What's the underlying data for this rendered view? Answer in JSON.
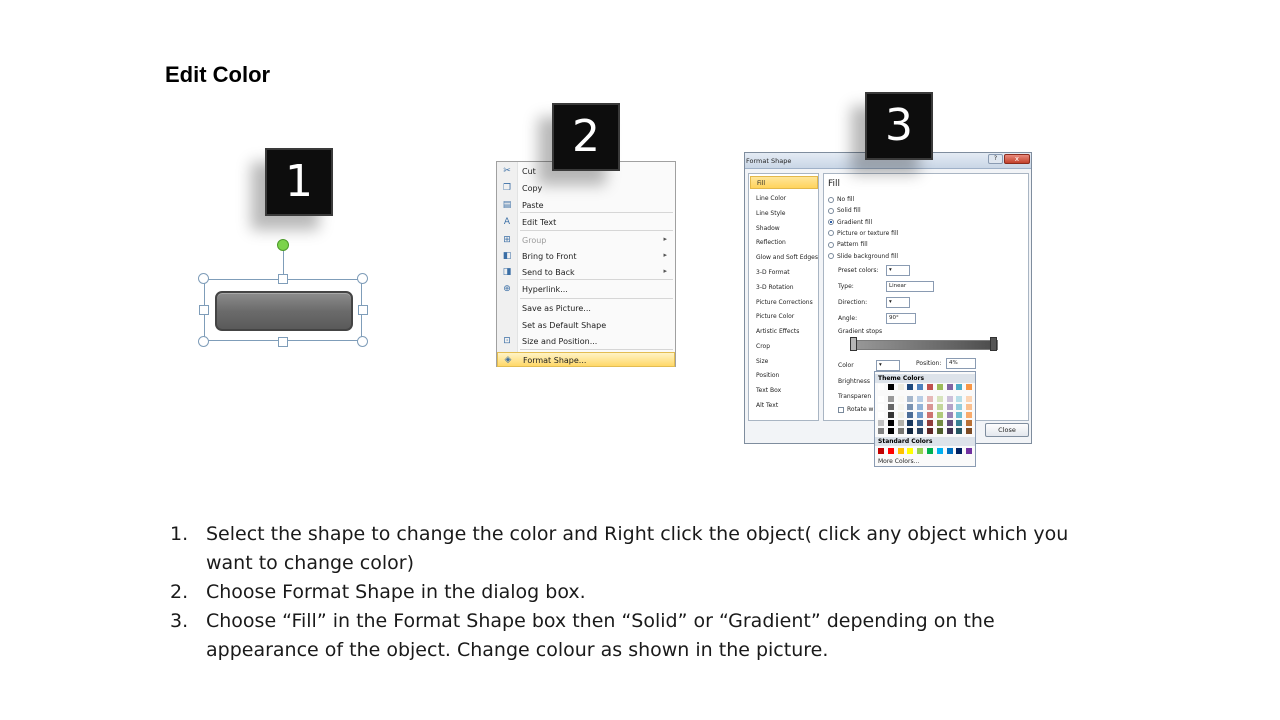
{
  "slide": {
    "title": "Edit Color"
  },
  "badges": [
    "1",
    "2",
    "3"
  ],
  "context_menu": {
    "items": [
      {
        "label": "Cut",
        "icon": "scissors-icon",
        "enabled": true,
        "submenu": false
      },
      {
        "label": "Copy",
        "icon": "copy-icon",
        "enabled": true,
        "submenu": false
      },
      {
        "label": "Paste",
        "icon": "paste-icon",
        "enabled": true,
        "submenu": false
      },
      {
        "label": "Edit Text",
        "icon": "edit-text-icon",
        "enabled": true,
        "submenu": false
      },
      {
        "label": "Group",
        "icon": "group-icon",
        "enabled": false,
        "submenu": true
      },
      {
        "label": "Bring to Front",
        "icon": "bring-front-icon",
        "enabled": true,
        "submenu": true
      },
      {
        "label": "Send to Back",
        "icon": "send-back-icon",
        "enabled": true,
        "submenu": true
      },
      {
        "label": "Hyperlink...",
        "icon": "hyperlink-icon",
        "enabled": true,
        "submenu": false
      },
      {
        "label": "Save as Picture...",
        "icon": "",
        "enabled": true,
        "submenu": false
      },
      {
        "label": "Set as Default Shape",
        "icon": "",
        "enabled": true,
        "submenu": false
      },
      {
        "label": "Size and Position...",
        "icon": "size-position-icon",
        "enabled": true,
        "submenu": false
      },
      {
        "label": "Format Shape...",
        "icon": "format-shape-icon",
        "enabled": true,
        "submenu": false,
        "highlighted": true
      }
    ]
  },
  "dialog": {
    "title": "Format Shape",
    "help": "?",
    "close_x": "x",
    "nav": [
      "Fill",
      "Line Color",
      "Line Style",
      "Shadow",
      "Reflection",
      "Glow and Soft Edges",
      "3-D Format",
      "3-D Rotation",
      "Picture Corrections",
      "Picture Color",
      "Artistic Effects",
      "Crop",
      "Size",
      "Position",
      "Text Box",
      "Alt Text"
    ],
    "selected_nav": "Fill",
    "fill_heading": "Fill",
    "fill_options": [
      "No fill",
      "Solid fill",
      "Gradient fill",
      "Picture or texture fill",
      "Pattern fill",
      "Slide background fill"
    ],
    "selected_fill": "Gradient fill",
    "preset_label": "Preset colors:",
    "type_label": "Type:",
    "type_value": "Linear",
    "direction_label": "Direction:",
    "angle_label": "Angle:",
    "angle_value": "90°",
    "gradient_stops_label": "Gradient stops",
    "color_label": "Color",
    "position_label": "Position:",
    "position_value": "4%",
    "brightness_label": "Brightness",
    "transparency_label": "Transparen",
    "rotate_label": "Rotate w",
    "close_button": "Close"
  },
  "palette": {
    "theme_label": "Theme Colors",
    "standard_label": "Standard Colors",
    "more_label": "More Colors...",
    "theme_top": [
      "#ffffff",
      "#000000",
      "#eeece1",
      "#1f497d",
      "#4f81bd",
      "#c0504d",
      "#9bbb59",
      "#8064a2",
      "#4bacc6",
      "#f79646"
    ],
    "standard": [
      "#c00000",
      "#ff0000",
      "#ffc000",
      "#ffff00",
      "#92d050",
      "#00b050",
      "#00b0f0",
      "#0070c0",
      "#002060",
      "#7030a0"
    ]
  },
  "instructions": [
    {
      "num": "1.",
      "text": "Select the shape to change the color and Right click the object( click any object which you want to change color)"
    },
    {
      "num": "2.",
      "text": "Choose Format Shape in the dialog box."
    },
    {
      "num": "3.",
      "text": "Choose “Fill” in the Format Shape box then “Solid” or “Gradient” depending on the appearance of the object. Change colour as shown in the picture."
    }
  ]
}
